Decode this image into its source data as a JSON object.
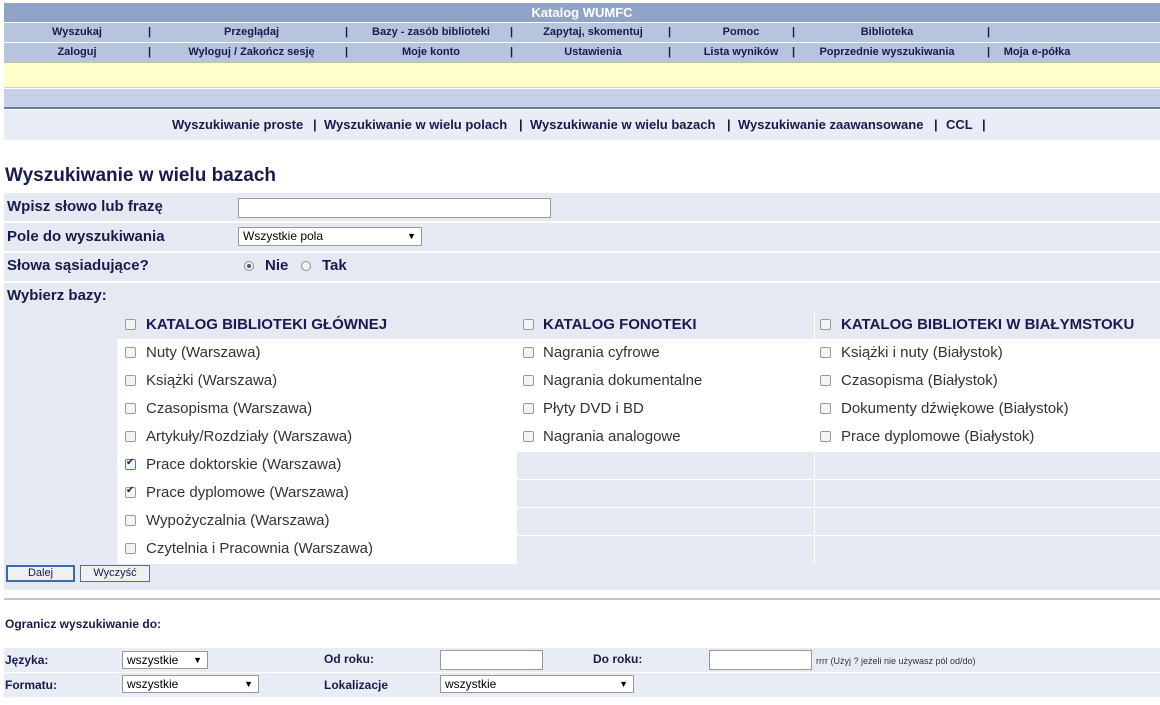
{
  "app_title": "Katalog WUMFC",
  "nav_row1": [
    "Wyszukaj",
    "Przeglądaj",
    "Bazy - zasób biblioteki",
    "Zapytaj, skomentuj",
    "Pomoc",
    "Biblioteka"
  ],
  "nav_row2": [
    "Zaloguj",
    "Wyloguj / Zakończ sesję",
    "Moje konto",
    "Ustawienia",
    "Lista wyników",
    "Poprzednie wyszukiwania",
    "Moja e-półka"
  ],
  "nav_separator": "|",
  "tabs": [
    "Wyszukiwanie proste",
    "Wyszukiwanie w wielu polach",
    "Wyszukiwanie w wielu bazach",
    "Wyszukiwanie zaawansowane",
    "CCL"
  ],
  "page_title": "Wyszukiwanie w wielu bazach",
  "form": {
    "search_label": "Wpisz słowo lub frazę",
    "search_value": "",
    "field_label": "Pole do wyszukiwania",
    "field_value": "Wszystkie pola",
    "adjacent_label": "Słowa sąsiadujące?",
    "adjacent_options": [
      "Nie",
      "Tak"
    ],
    "adjacent_selected": "Nie",
    "choose_db_label": "Wybierz bazy:"
  },
  "databases": {
    "columns": [
      {
        "header": "KATALOG BIBLIOTEKI GŁÓWNEJ",
        "checked": false,
        "items": [
          {
            "label": "Nuty (Warszawa)",
            "checked": false
          },
          {
            "label": "Książki (Warszawa)",
            "checked": false
          },
          {
            "label": "Czasopisma (Warszawa)",
            "checked": false
          },
          {
            "label": "Artykuły/Rozdziały (Warszawa)",
            "checked": false
          },
          {
            "label": "Prace doktorskie (Warszawa)",
            "checked": true
          },
          {
            "label": "Prace dyplomowe (Warszawa)",
            "checked": true
          },
          {
            "label": "Wypożyczalnia (Warszawa)",
            "checked": false
          },
          {
            "label": "Czytelnia i Pracownia (Warszawa)",
            "checked": false
          }
        ]
      },
      {
        "header": "KATALOG FONOTEKI",
        "checked": false,
        "items": [
          {
            "label": "Nagrania cyfrowe",
            "checked": false
          },
          {
            "label": "Nagrania dokumentalne",
            "checked": false
          },
          {
            "label": "Płyty DVD i BD",
            "checked": false
          },
          {
            "label": "Nagrania analogowe",
            "checked": false
          }
        ]
      },
      {
        "header": "KATALOG BIBLIOTEKI W BIAŁYMSTOKU",
        "checked": false,
        "items": [
          {
            "label": "Książki i nuty (Białystok)",
            "checked": false
          },
          {
            "label": "Czasopisma (Białystok)",
            "checked": false
          },
          {
            "label": "Dokumenty dźwiękowe (Białystok)",
            "checked": false
          },
          {
            "label": "Prace dyplomowe (Białystok)",
            "checked": false
          }
        ]
      }
    ]
  },
  "buttons": {
    "next": "Dalej",
    "clear": "Wyczyść"
  },
  "limits": {
    "title": "Ogranicz wyszukiwanie do:",
    "language_label": "Języka:",
    "language_value": "wszystkie",
    "from_year_label": "Od roku:",
    "from_year_value": "",
    "to_year_label": "Do roku:",
    "to_year_value": "",
    "year_hint": "rrrr (Użyj ? jeżeli nie używasz pól od/do)",
    "format_label": "Formatu:",
    "format_value": "wszystkie",
    "location_label": "Lokalizacje",
    "location_value": "wszystkie"
  },
  "icons": {
    "dropdown": "chevron-down-icon",
    "checked": "check-icon"
  }
}
